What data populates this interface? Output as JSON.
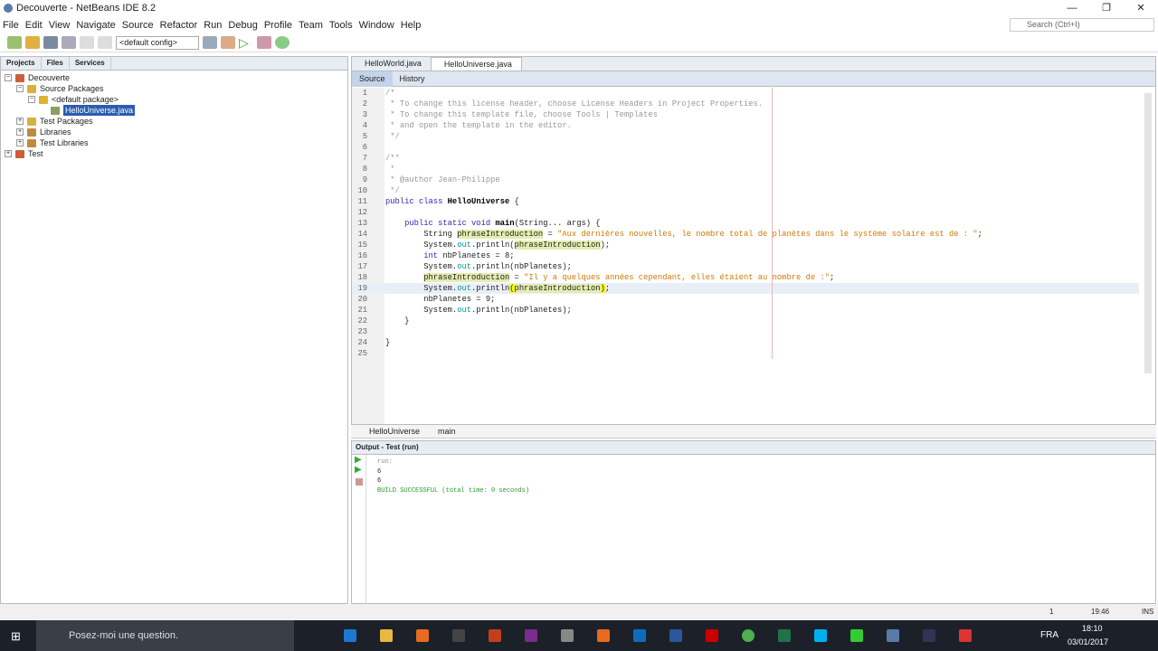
{
  "window": {
    "title": "Decouverte - NetBeans IDE 8.2",
    "controls": [
      "—",
      "❐",
      "✕"
    ]
  },
  "menu": [
    "File",
    "Edit",
    "View",
    "Navigate",
    "Source",
    "Refactor",
    "Run",
    "Debug",
    "Profile",
    "Team",
    "Tools",
    "Window",
    "Help"
  ],
  "search": {
    "placeholder": "Search (Ctrl+I)"
  },
  "toolbar": {
    "config": "<default config>"
  },
  "projects": {
    "tabs": [
      "Projects",
      "Files",
      "Services"
    ],
    "tree": [
      {
        "label": "Decouverte",
        "lvl": 0,
        "exp": "−",
        "col": "#c9603a"
      },
      {
        "label": "Source Packages",
        "lvl": 1,
        "exp": "−",
        "col": "#d8b040"
      },
      {
        "label": "<default package>",
        "lvl": 2,
        "exp": "−",
        "col": "#e0b030"
      },
      {
        "label": "HelloUniverse.java",
        "lvl": 3,
        "exp": "",
        "col": "#8aa060",
        "sel": true
      },
      {
        "label": "Test Packages",
        "lvl": 1,
        "exp": "+",
        "col": "#d8b040"
      },
      {
        "label": "Libraries",
        "lvl": 1,
        "exp": "+",
        "col": "#c08a40"
      },
      {
        "label": "Test Libraries",
        "lvl": 1,
        "exp": "+",
        "col": "#c08a40"
      },
      {
        "label": "Test",
        "lvl": 0,
        "exp": "+",
        "col": "#c9603a"
      }
    ]
  },
  "editor": {
    "tabs": [
      "HelloWorld.java",
      "HelloUniverse.java"
    ],
    "source_label": "Source",
    "history_label": "History",
    "lines": [
      [
        [
          "c",
          "/*"
        ]
      ],
      [
        [
          "c",
          " * To change this license header, choose License Headers in Project Properties."
        ]
      ],
      [
        [
          "c",
          " * To change this template file, choose Tools | Templates"
        ]
      ],
      [
        [
          "c",
          " * and open the template in the editor."
        ]
      ],
      [
        [
          "c",
          " */"
        ]
      ],
      [],
      [
        [
          "c",
          "/**"
        ]
      ],
      [
        [
          "c",
          " *"
        ]
      ],
      [
        [
          "c",
          " * @author Jean-Philippe"
        ]
      ],
      [
        [
          "c",
          " */"
        ]
      ],
      [
        [
          "k",
          "public class "
        ],
        [
          "kb",
          "HelloUniverse"
        ],
        [
          "n",
          " {"
        ]
      ],
      [],
      [
        [
          "n",
          "    "
        ],
        [
          "k",
          "public static void "
        ],
        [
          "kb",
          "main"
        ],
        [
          "n",
          "(String... args) {"
        ]
      ],
      [
        [
          "n",
          "        String "
        ],
        [
          "h",
          "phraseIntroduction"
        ],
        [
          "n",
          " = "
        ],
        [
          "s",
          "\"Aux dernières nouvelles, le nombre total de planètes dans le système solaire est de : \""
        ],
        [
          "n",
          ";"
        ]
      ],
      [
        [
          "n",
          "        System."
        ],
        [
          "f",
          "out"
        ],
        [
          "n",
          ".println("
        ],
        [
          "h",
          "phraseIntroduction"
        ],
        [
          "n",
          ");"
        ]
      ],
      [
        [
          "n",
          "        "
        ],
        [
          "k",
          "int"
        ],
        [
          "n",
          " nbPlanetes = 8;"
        ]
      ],
      [
        [
          "n",
          "        System."
        ],
        [
          "f",
          "out"
        ],
        [
          "n",
          ".println(nbPlanetes);"
        ]
      ],
      [
        [
          "n",
          "        "
        ],
        [
          "h",
          "phraseIntroduction"
        ],
        [
          "n",
          " = "
        ],
        [
          "s",
          "\"Il y a quelques années cependant, elles étaient au nombre de :\""
        ],
        [
          "n",
          ";"
        ]
      ],
      [
        [
          "n",
          "        System."
        ],
        [
          "f",
          "out"
        ],
        [
          "n",
          ".println"
        ],
        [
          "hy",
          "("
        ],
        [
          "h",
          "phraseIntroduction"
        ],
        [
          "hy",
          ")"
        ],
        [
          "n",
          ";"
        ]
      ],
      [
        [
          "n",
          "        nbPlanetes = 9;"
        ]
      ],
      [
        [
          "n",
          "        System."
        ],
        [
          "f",
          "out"
        ],
        [
          "n",
          ".println(nbPlanetes);"
        ]
      ],
      [
        [
          "n",
          "    }"
        ]
      ],
      [],
      [
        [
          "n",
          "}"
        ]
      ],
      []
    ],
    "current_line": 19
  },
  "breadcrumb": [
    "HelloUniverse",
    "main"
  ],
  "output": {
    "tab": "Output - Test (run)",
    "lines": [
      "run:",
      "6",
      "6",
      "BUILD SUCCESSFUL (total time: 0 seconds)"
    ]
  },
  "status": {
    "notifications": "1",
    "position": "19:46",
    "mode": "INS"
  },
  "taskbar": {
    "cortana": "Posez-moi une question.",
    "lang": "FRA",
    "time": "18:10",
    "date": "03/01/2017"
  }
}
